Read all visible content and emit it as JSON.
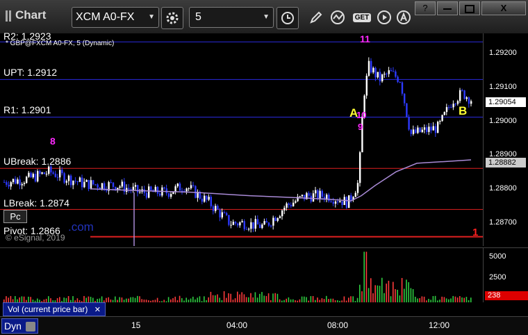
{
  "toolbar": {
    "title": "Chart",
    "symbol": "XCM A0-FX",
    "interval": "5",
    "get_label": "GET",
    "window_help": "?",
    "window_close": "X"
  },
  "chart": {
    "series_label": "* GBP@FXCM A0-FX, 5 (Dynamic)",
    "copyright": "© eSignal, 2019",
    "watermark": ".com",
    "pc_badge": "Pc",
    "levels": [
      {
        "label": "R2: 1.2923",
        "value": 1.2923,
        "color": "#2a2ae0"
      },
      {
        "label": "UPT: 1.2912",
        "value": 1.2912,
        "color": "#2a2ae0"
      },
      {
        "label": "R1: 1.2901",
        "value": 1.2901,
        "color": "#2a2ae0"
      },
      {
        "label": "UBreak: 1.2886",
        "value": 1.2886,
        "color": "#e02020"
      },
      {
        "label": "LBreak: 1.2874",
        "value": 1.2874,
        "color": "#e02020"
      },
      {
        "label": "Pivot: 1.2866",
        "value": 1.2866,
        "color": "#e02020"
      }
    ],
    "markers": {
      "m8": "8",
      "m11": "11",
      "mA": "A",
      "mB": "B",
      "m10": "10",
      "m9": "9",
      "m1": "1"
    },
    "price_ticks": [
      "1.29200",
      "1.29100",
      "1.29000",
      "1.28900",
      "1.28800",
      "1.28700"
    ],
    "current_price": "1.29054",
    "ma_price": "1.28882"
  },
  "volume": {
    "label": "Vol (current price bar)",
    "ticks": [
      "5000",
      "2500"
    ],
    "current": "238"
  },
  "time_axis": {
    "label": "Dyn",
    "ticks": [
      "15",
      "04:00",
      "08:00",
      "12:00"
    ]
  },
  "chart_data": {
    "type": "candlestick",
    "y_range": [
      1.2864,
      1.2928
    ],
    "volume_range": [
      0,
      6000
    ],
    "time_ticks": [
      "15",
      "04:00",
      "08:00",
      "12:00"
    ]
  }
}
